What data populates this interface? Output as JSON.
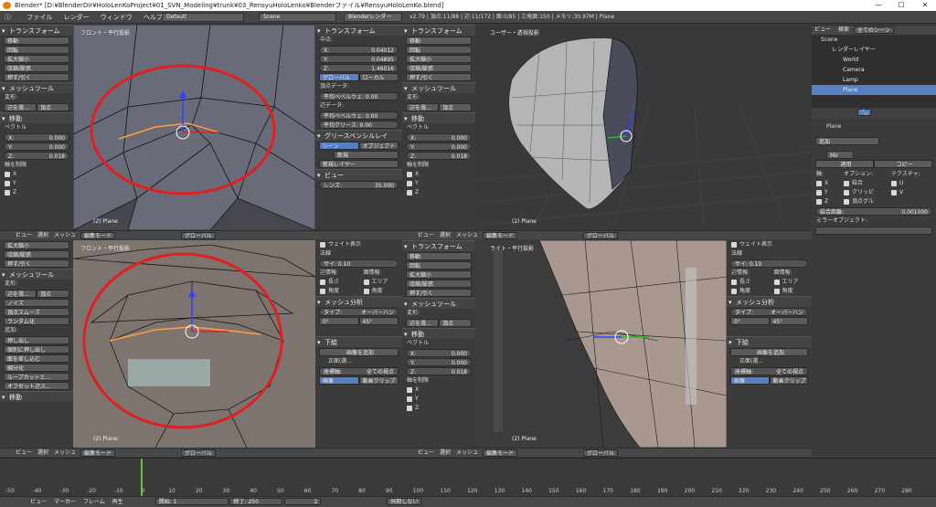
{
  "window": {
    "title": "Blender* [D:¥BlenderDir¥HoloLenKoProject¥01_SVN_Modeling¥trunk¥03_RensyuHoloLenko¥Blenderファイル¥RensyuHoloLenKo.blend]",
    "min": "—",
    "max": "☐",
    "close": "✕"
  },
  "menu": {
    "file": "ファイル",
    "render": "レンダー",
    "window": "ウィンドウ",
    "help": "ヘルプ",
    "layout": "Default",
    "scene": "Scene",
    "engine": "Blenderレンダー",
    "stats": "v2.79 | 頂点:11/88 | 辺:11/172 | 面:0/85 | 三角面:150 | メモリ:30.97M | Plane"
  },
  "tools": {
    "transform": "トランスフォーム",
    "move": "移動",
    "rotate": "回転",
    "scale": "拡大縮小",
    "mirror": "収縮/膨張",
    "extrude": "押す/引く",
    "meshtools": "メッシュツール",
    "deform": "変形:",
    "slide": "辺を滑...",
    "vertex": "頂点",
    "noise": "ノイズ",
    "smooth": "頂点スムーズ",
    "random": "ランダム化",
    "add": "追加:",
    "extrude_region": "押し出し",
    "extrude_indiv": "個別に押し出し",
    "inset": "面を差し込む",
    "subdiv": "細分化",
    "loopcut": "ループカットと...",
    "offset": "オフセット辺ス..."
  },
  "op": {
    "title": "移動",
    "vector": "ベクトル",
    "x": "X:",
    "xv": "0.000",
    "y": "Y:",
    "yv": "0.000",
    "z": "Z:",
    "zv": "0.018",
    "constraint": "軸を制限",
    "cx": "X",
    "cy": "Y",
    "cz": "Z"
  },
  "props": {
    "transform": "トランスフォーム",
    "median": "中点:",
    "x": "X:",
    "xv": "0.04012",
    "y": "Y:",
    "yv": "0.04895",
    "z": "Z:",
    "zv": "1.46016",
    "global": "グローバル",
    "local": "ローカル",
    "vdata": "頂点データ:",
    "bevel_w": "平均ベベルウェ: 0.00",
    "edata": "辺データ:",
    "bevel_w2": "平均ベベルウェ: 0.00",
    "crease": "平均クリース: 0.00",
    "gpencil": "グリースペンシルレイ",
    "scene": "シーン",
    "object": "オブジェクト",
    "new": "新規",
    "newlayer": "新規レイヤー",
    "view": "ビュー",
    "lens": "レンズ:",
    "lensv": "35.000",
    "weight": "ウェイト表示",
    "normal": "法線",
    "size": "サイ: 0.10",
    "edgeinfo": "辺情報:",
    "faceinfo": "面情報:",
    "length": "長さ",
    "area": "エリア",
    "angle": "角度",
    "angle2": "角度",
    "meshanalysis": "メッシュ分析",
    "type": "タイプ:",
    "overhang": "オーバーハン",
    "a0": "0°",
    "a45": "45°",
    "bgimg": "下絵",
    "addimg": "画像を追加",
    "front": "正面(選...",
    "axis": "座標軸:",
    "allviews": "全ての視点",
    "image": "画像",
    "movieclip": "動画クリップ"
  },
  "views": {
    "tl": "フロント・平行投影",
    "tr": "ユーザー・透視投影",
    "bl": "フロント・平行投影",
    "br": "ライト・平行投影",
    "obj": "(2) Plane"
  },
  "vhdr": {
    "view": "ビュー",
    "select": "選択",
    "mesh": "メッシュ",
    "mode": "編集モード",
    "orient": "グローバル"
  },
  "outliner": {
    "view": "ビュー",
    "search": "検索",
    "all": "全てのシーン",
    "scene": "Scene",
    "renderlayer": "レンダーレイヤー",
    "world": "World",
    "camera": "Camera",
    "lamp": "Lamp",
    "plane": "Plane"
  },
  "modifier": {
    "obj": "Plane",
    "add": "追加",
    "mir": "Mir",
    "apply": "適用",
    "copy": "コピー",
    "axis": "軸:",
    "options": "オプション:",
    "texture": "テクスチャ:",
    "x": "X",
    "y": "Y",
    "z": "Z",
    "merge": "結合",
    "clip": "クリッピ",
    "vgroup": "頂点グル",
    "u": "U",
    "v": "V",
    "dist": "結合距離:",
    "distv": "0.001000",
    "mirobj": "ミラーオブジェクト:"
  },
  "timeline": {
    "view": "ビュー",
    "marker": "マーカー",
    "frame": "フレーム",
    "play": "再生",
    "start": "開始:",
    "startv": "1",
    "end": "終了:",
    "endv": "250",
    "cur": "2",
    "sync": "同期しない",
    "ticks": [
      "-50",
      "-40",
      "-30",
      "-20",
      "-10",
      "0",
      "10",
      "20",
      "30",
      "40",
      "50",
      "60",
      "70",
      "80",
      "90",
      "100",
      "110",
      "120",
      "130",
      "140",
      "150",
      "160",
      "170",
      "180",
      "190",
      "200",
      "210",
      "220",
      "230",
      "240",
      "250",
      "260",
      "270",
      "280"
    ]
  },
  "colors": {
    "accent": "#5680c2",
    "select": "#ffa040",
    "circle": "#e02020"
  }
}
